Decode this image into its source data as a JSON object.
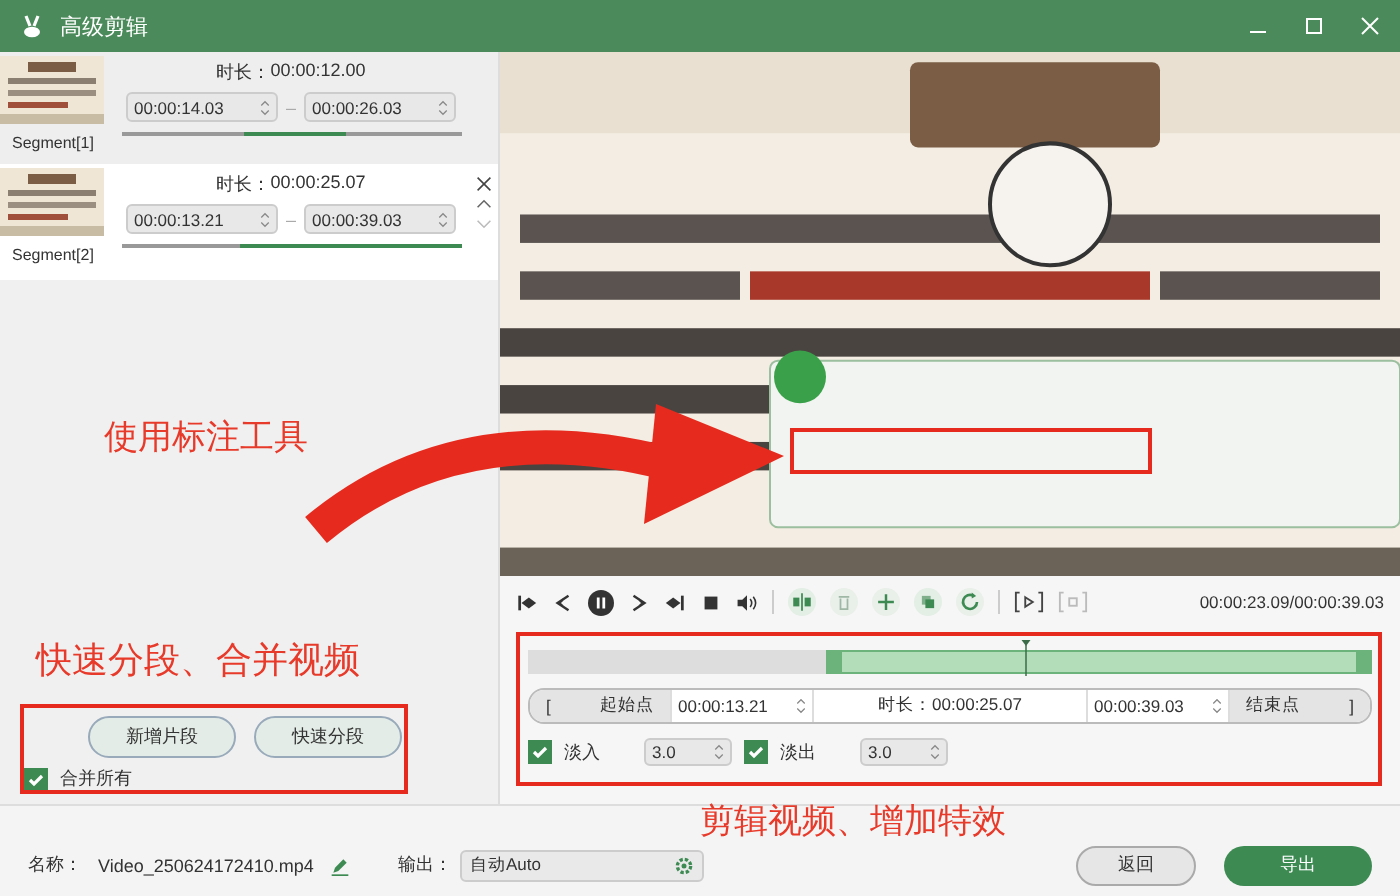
{
  "window": {
    "title": "高级剪辑"
  },
  "segments": [
    {
      "label": "Segment[1]",
      "duration_label": "时长：",
      "duration": "00:00:12.00",
      "start": "00:00:14.03",
      "separator": "–",
      "end": "00:00:26.03",
      "selected": false
    },
    {
      "label": "Segment[2]",
      "duration_label": "时长：",
      "duration": "00:00:25.07",
      "start": "00:00:13.21",
      "separator": "–",
      "end": "00:00:39.03",
      "selected": true
    }
  ],
  "annotations": [
    "使用标注工具",
    "快速分段、合并视频",
    "剪辑视频、增加特效"
  ],
  "segment_actions": {
    "add": "新增片段",
    "split": "快速分段",
    "merge_all": {
      "label": "合并所有",
      "checked": true
    }
  },
  "player": {
    "time": "00:00:23.09/00:00:39.03"
  },
  "timeline": {
    "level": 0.59
  },
  "trim": {
    "bracket_left": "[",
    "start_button": "起始点",
    "start": "00:00:13.21",
    "duration_label": "时长：",
    "duration": "00:00:25.07",
    "end": "00:00:39.03",
    "end_button": "结束点",
    "bracket_right": "]"
  },
  "fade": [
    {
      "label": "淡入",
      "checked": true,
      "value": "3.0"
    },
    {
      "label": "淡出",
      "checked": true,
      "value": "3.0"
    }
  ],
  "footer": {
    "name_label": "名称：",
    "name": "Video_250624172410.mp4",
    "output_label": "输出：",
    "output": "自动Auto",
    "back": "返回",
    "export": "导出"
  }
}
